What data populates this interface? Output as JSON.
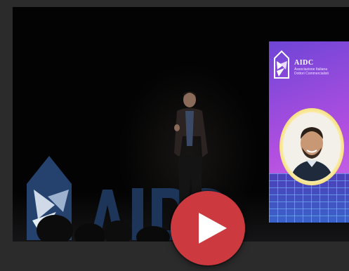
{
  "video": {
    "screen": {
      "brand": "AIDC",
      "subtitle_line1": "Associazione Italiana",
      "subtitle_line2": "Dottori Commercialisti"
    },
    "stage_logo_text": "AIDC",
    "play_button_label": "Play",
    "colors": {
      "play_button": "#cc3a3f",
      "screen_gradient_start": "#6e45d6",
      "screen_gradient_end": "#d36ee8",
      "portrait_ring": "#f0d34a",
      "background": "#2b2b2b"
    }
  }
}
